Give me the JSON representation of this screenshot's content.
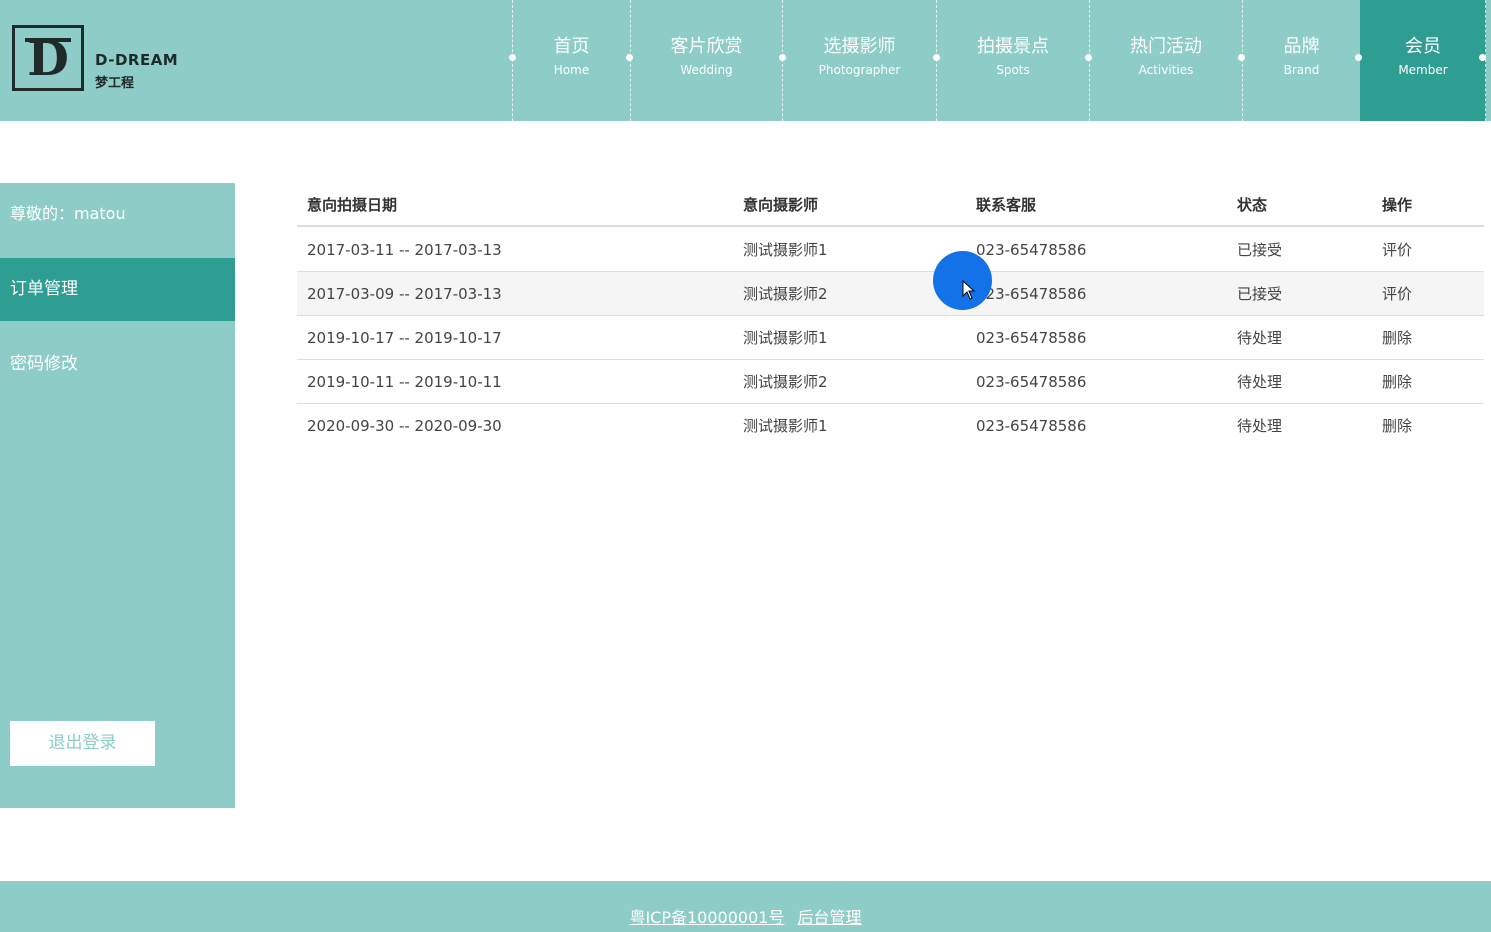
{
  "brand": {
    "logo_letter": "D",
    "name": "D-DREAM",
    "subname": "梦工程"
  },
  "nav": [
    {
      "cn": "首页",
      "en": "Home"
    },
    {
      "cn": "客片欣赏",
      "en": "Wedding"
    },
    {
      "cn": "选摄影师",
      "en": "Photographer"
    },
    {
      "cn": "拍摄景点",
      "en": "Spots"
    },
    {
      "cn": "热门活动",
      "en": "Activities"
    },
    {
      "cn": "品牌",
      "en": "Brand"
    },
    {
      "cn": "会员",
      "en": "Member"
    }
  ],
  "nav_active": "会员",
  "sidebar": {
    "greeting": "尊敬的：matou",
    "items": [
      {
        "label": "订单管理",
        "active": true
      },
      {
        "label": "密码修改",
        "active": false
      }
    ],
    "logout_label": "退出登录"
  },
  "table": {
    "headers": [
      "意向拍摄日期",
      "意向摄影师",
      "联系客服",
      "状态",
      "操作"
    ],
    "rows": [
      {
        "date": "2017-03-11 -- 2017-03-13",
        "photographer": "测试摄影师1",
        "phone": "023-65478586",
        "status": "已接受",
        "action": "评价"
      },
      {
        "date": "2017-03-09 -- 2017-03-13",
        "photographer": "测试摄影师2",
        "phone": "023-65478586",
        "status": "已接受",
        "action": "评价"
      },
      {
        "date": "2019-10-17 -- 2019-10-17",
        "photographer": "测试摄影师1",
        "phone": "023-65478586",
        "status": "待处理",
        "action": "删除"
      },
      {
        "date": "2019-10-11 -- 2019-10-11",
        "photographer": "测试摄影师2",
        "phone": "023-65478586",
        "status": "待处理",
        "action": "删除"
      },
      {
        "date": "2020-09-30 -- 2020-09-30",
        "photographer": "测试摄影师1",
        "phone": "023-65478586",
        "status": "待处理",
        "action": "删除"
      }
    ]
  },
  "footer": {
    "icp": "粤ICP备10000001号",
    "admin": "后台管理"
  },
  "colors": {
    "teal_light": "#8ecdc7",
    "teal_dark": "#2f9e92",
    "cursor_blue": "#1472e8"
  }
}
